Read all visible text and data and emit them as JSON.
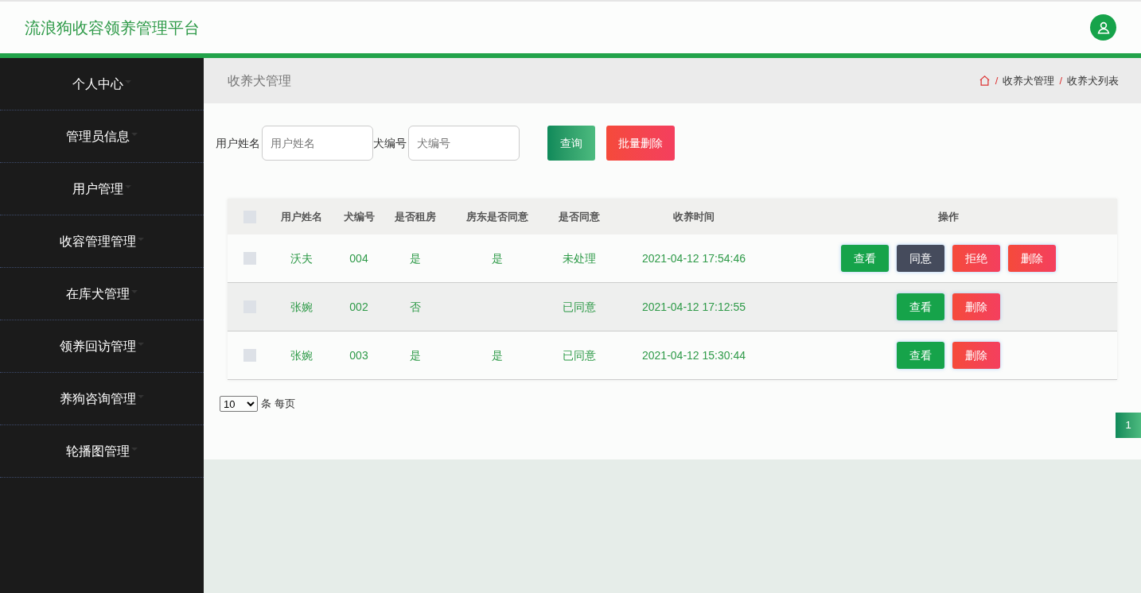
{
  "header": {
    "title": "流浪狗收容领养管理平台"
  },
  "sidebar": {
    "items": [
      {
        "label": "个人中心"
      },
      {
        "label": "管理员信息"
      },
      {
        "label": "用户管理"
      },
      {
        "label": "收容管理管理"
      },
      {
        "label": "在库犬管理"
      },
      {
        "label": "领养回访管理"
      },
      {
        "label": "养狗咨询管理"
      },
      {
        "label": "轮播图管理"
      }
    ]
  },
  "page_title": "收养犬管理",
  "breadcrumb": {
    "separator": "/",
    "items": [
      "收养犬管理",
      "收养犬列表"
    ]
  },
  "search": {
    "fields": [
      {
        "label": "用户姓名",
        "placeholder": "用户姓名"
      },
      {
        "label": "犬编号",
        "placeholder": "犬编号"
      }
    ],
    "buttons": [
      {
        "label": "查询",
        "kind": "search"
      },
      {
        "label": "批量删除",
        "kind": "danger"
      }
    ]
  },
  "table": {
    "select_all_checked": false,
    "columns": [
      "用户姓名",
      "犬编号",
      "是否租房",
      "房东是否同意",
      "是否同意",
      "收养时间",
      "操作"
    ],
    "rows": [
      {
        "checked": false,
        "cells": [
          "沃夫",
          "004",
          "是",
          "是",
          "未处理",
          "2021-04-12 17:54:46"
        ],
        "actions": [
          {
            "label": "查看",
            "kind": "view"
          },
          {
            "label": "同意",
            "kind": "approve"
          },
          {
            "label": "拒绝",
            "kind": "reject"
          },
          {
            "label": "删除",
            "kind": "delete"
          }
        ]
      },
      {
        "checked": false,
        "cells": [
          "张婉",
          "002",
          "否",
          null,
          "已同意",
          "2021-04-12 17:12:55"
        ],
        "actions": [
          {
            "label": "查看",
            "kind": "view"
          },
          {
            "label": "删除",
            "kind": "delete"
          }
        ]
      },
      {
        "checked": false,
        "cells": [
          "张婉",
          "003",
          "是",
          "是",
          "已同意",
          "2021-04-12 15:30:44"
        ],
        "actions": [
          {
            "label": "查看",
            "kind": "view"
          },
          {
            "label": "删除",
            "kind": "delete"
          }
        ]
      }
    ]
  },
  "pagination": {
    "page_size": "10",
    "page_size_label": "条 每页",
    "pages": [
      {
        "label": "1",
        "selected": true
      }
    ]
  }
}
